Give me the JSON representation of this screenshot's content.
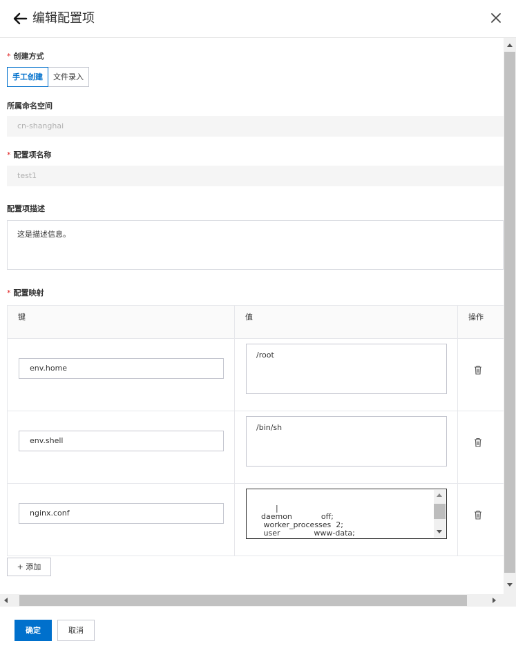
{
  "header": {
    "title": "编辑配置项"
  },
  "form": {
    "create_method": {
      "label": "创建方式",
      "options": [
        "手工创建",
        "文件录入"
      ],
      "selected": "手工创建"
    },
    "namespace": {
      "label": "所属命名空间",
      "value": "cn-shanghai"
    },
    "name": {
      "label": "配置项名称",
      "value": "test1"
    },
    "description": {
      "label": "配置项描述",
      "value": "这是描述信息。"
    },
    "mapping": {
      "label": "配置映射",
      "columns": [
        "键",
        "值",
        "操作"
      ],
      "rows": [
        {
          "key": "env.home",
          "value": "/root"
        },
        {
          "key": "env.shell",
          "value": "/bin/sh"
        },
        {
          "key": "nginx.conf",
          "value": "|\n  daemon            off;\n   worker_processes  2;\n   user              www-data;"
        }
      ],
      "add_label": "+ 添加"
    },
    "required_mark": "*"
  },
  "footer": {
    "ok_label": "确定",
    "cancel_label": "取消"
  },
  "colors": {
    "primary": "#0070cc",
    "required": "#e02020"
  }
}
